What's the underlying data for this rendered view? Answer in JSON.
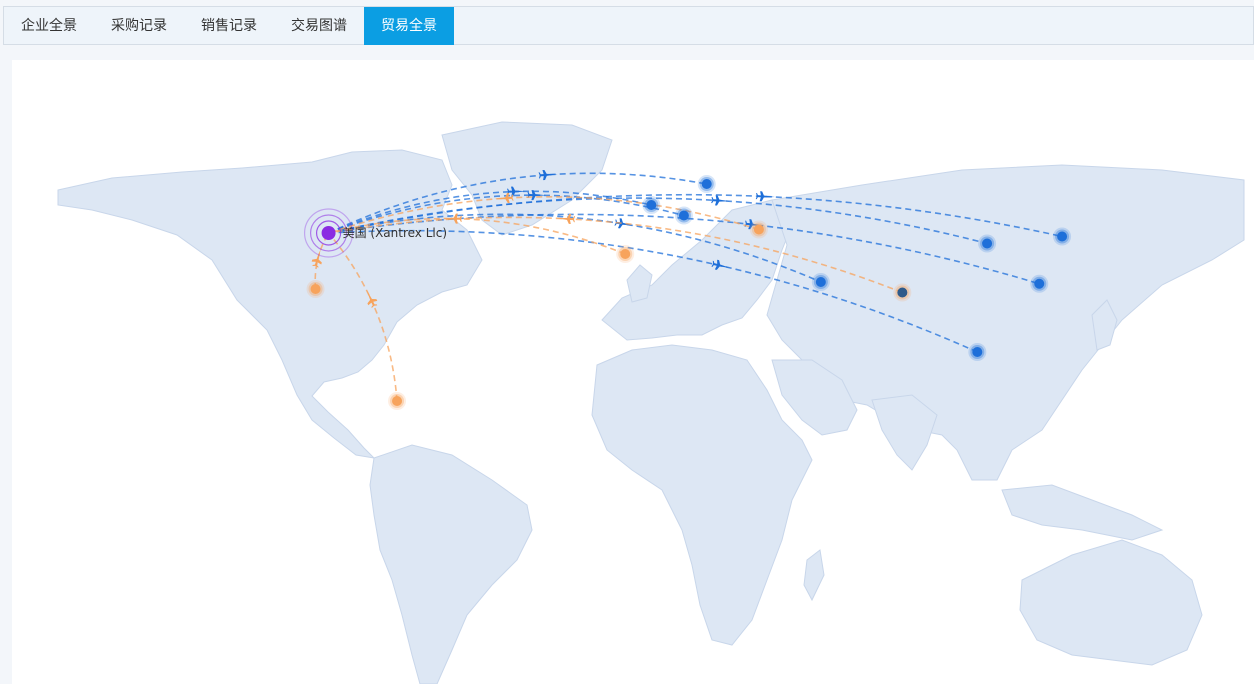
{
  "tabs": [
    {
      "label": "企业全景",
      "active": false
    },
    {
      "label": "采购记录",
      "active": false
    },
    {
      "label": "销售记录",
      "active": false
    },
    {
      "label": "交易图谱",
      "active": false
    },
    {
      "label": "贸易全景",
      "active": true
    }
  ],
  "map": {
    "origin": {
      "name": "美国 (Xantrex Llc)",
      "lon": -97,
      "lat": 38
    },
    "colors": {
      "export": "#1e6fd9",
      "import": "#f7a35c",
      "origin": "#8a2be2",
      "land": "#dde7f4",
      "highlight": "#2f5a8a"
    },
    "export_destinations": [
      {
        "name": "france",
        "lon": 2,
        "lat": 46
      },
      {
        "name": "italy",
        "lon": 12,
        "lat": 43
      },
      {
        "name": "china",
        "lon": 105,
        "lat": 35
      },
      {
        "name": "korea",
        "lon": 128,
        "lat": 37
      },
      {
        "name": "taiwan",
        "lon": 121,
        "lat": 23.5
      },
      {
        "name": "uae",
        "lon": 54,
        "lat": 24
      },
      {
        "name": "malaysia",
        "lon": 102,
        "lat": 4
      },
      {
        "name": "poland",
        "lon": 19,
        "lat": 52
      }
    ],
    "import_sources": [
      {
        "name": "mexico",
        "lon": -101,
        "lat": 22
      },
      {
        "name": "peru",
        "lon": -76,
        "lat": -10
      },
      {
        "name": "turkey",
        "lon": 35,
        "lat": 39
      },
      {
        "name": "india",
        "lon": 79,
        "lat": 21,
        "highlight": true
      },
      {
        "name": "morocco",
        "lon": -6,
        "lat": 32
      }
    ]
  }
}
